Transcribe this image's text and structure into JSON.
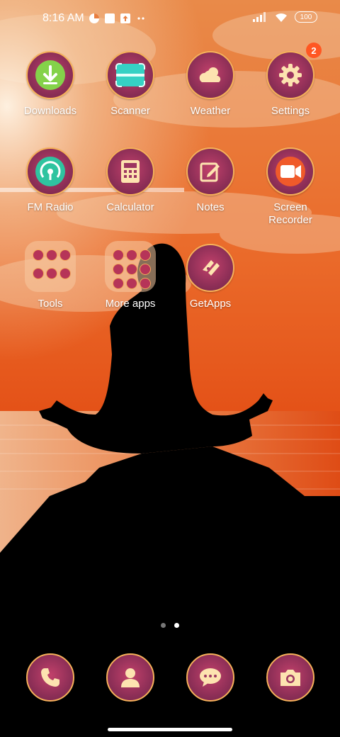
{
  "status_bar": {
    "time": "8:16 AM",
    "battery": "100",
    "icons": [
      "data-saver-icon",
      "notification-square-icon",
      "upload-box-icon",
      "more-dots-icon",
      "signal-icon",
      "wifi-icon",
      "battery-icon"
    ]
  },
  "home": {
    "apps": [
      {
        "label": "Downloads",
        "icon": "download-icon"
      },
      {
        "label": "Scanner",
        "icon": "scanner-icon"
      },
      {
        "label": "Weather",
        "icon": "weather-icon"
      },
      {
        "label": "Settings",
        "icon": "gear-icon",
        "badge": "2"
      },
      {
        "label": "FM Radio",
        "icon": "radio-icon"
      },
      {
        "label": "Calculator",
        "icon": "calculator-icon"
      },
      {
        "label": "Notes",
        "icon": "notes-icon"
      },
      {
        "label": "Screen Recorder",
        "icon": "screen-recorder-icon"
      },
      {
        "label": "Tools",
        "icon": "folder-icon"
      },
      {
        "label": "More apps",
        "icon": "folder-icon"
      },
      {
        "label": "GetApps",
        "icon": "getapps-icon"
      }
    ]
  },
  "page_indicator": {
    "pages": 2,
    "current": 2
  },
  "dock": [
    {
      "icon": "phone-icon"
    },
    {
      "icon": "contacts-icon"
    },
    {
      "icon": "messages-icon"
    },
    {
      "icon": "camera-icon"
    }
  ],
  "colors": {
    "accent": "#f6b15a",
    "icon_fill": "#9c3560",
    "badge": "#ff5722",
    "sky": "#e8551e"
  }
}
